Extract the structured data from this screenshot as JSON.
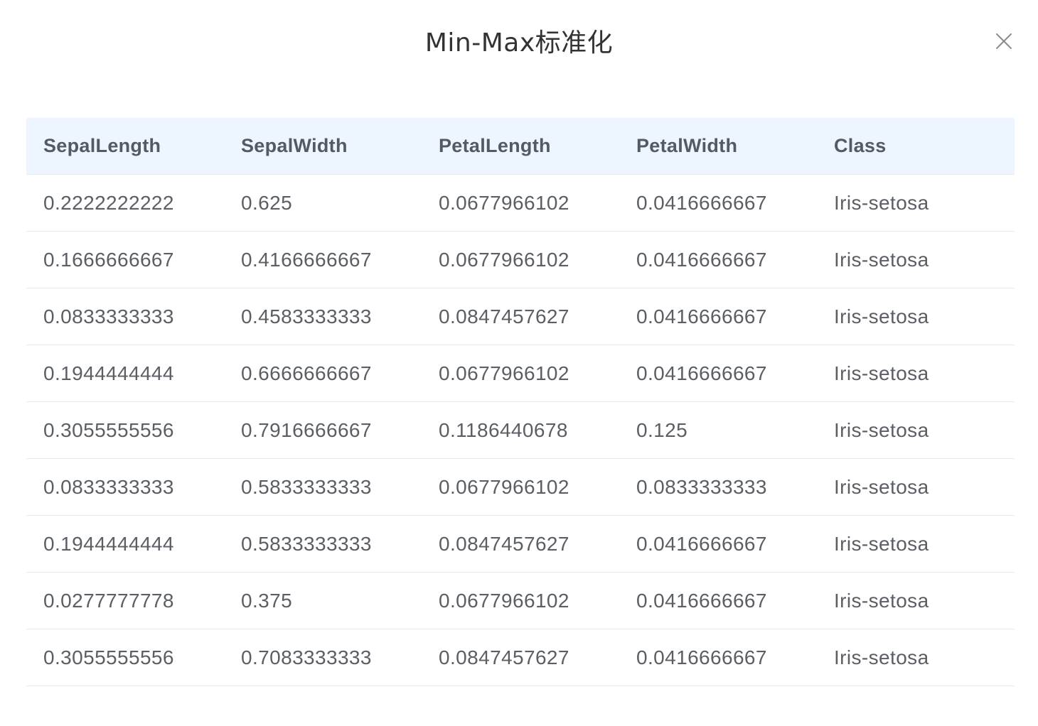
{
  "dialog": {
    "title": "Min-Max标准化",
    "close_icon": "close-icon"
  },
  "table": {
    "columns": [
      "SepalLength",
      "SepalWidth",
      "PetalLength",
      "PetalWidth",
      "Class"
    ],
    "rows": [
      [
        "0.2222222222",
        "0.625",
        "0.0677966102",
        "0.0416666667",
        "Iris-setosa"
      ],
      [
        "0.1666666667",
        "0.4166666667",
        "0.0677966102",
        "0.0416666667",
        "Iris-setosa"
      ],
      [
        "0.0833333333",
        "0.4583333333",
        "0.0847457627",
        "0.0416666667",
        "Iris-setosa"
      ],
      [
        "0.1944444444",
        "0.6666666667",
        "0.0677966102",
        "0.0416666667",
        "Iris-setosa"
      ],
      [
        "0.3055555556",
        "0.7916666667",
        "0.1186440678",
        "0.125",
        "Iris-setosa"
      ],
      [
        "0.0833333333",
        "0.5833333333",
        "0.0677966102",
        "0.0833333333",
        "Iris-setosa"
      ],
      [
        "0.1944444444",
        "0.5833333333",
        "0.0847457627",
        "0.0416666667",
        "Iris-setosa"
      ],
      [
        "0.0277777778",
        "0.375",
        "0.0677966102",
        "0.0416666667",
        "Iris-setosa"
      ],
      [
        "0.3055555556",
        "0.7083333333",
        "0.0847457627",
        "0.0416666667",
        "Iris-setosa"
      ]
    ]
  },
  "colors": {
    "header_bg": "#edf5fe",
    "text": "#5a5f66",
    "border": "#e8ecf1"
  }
}
